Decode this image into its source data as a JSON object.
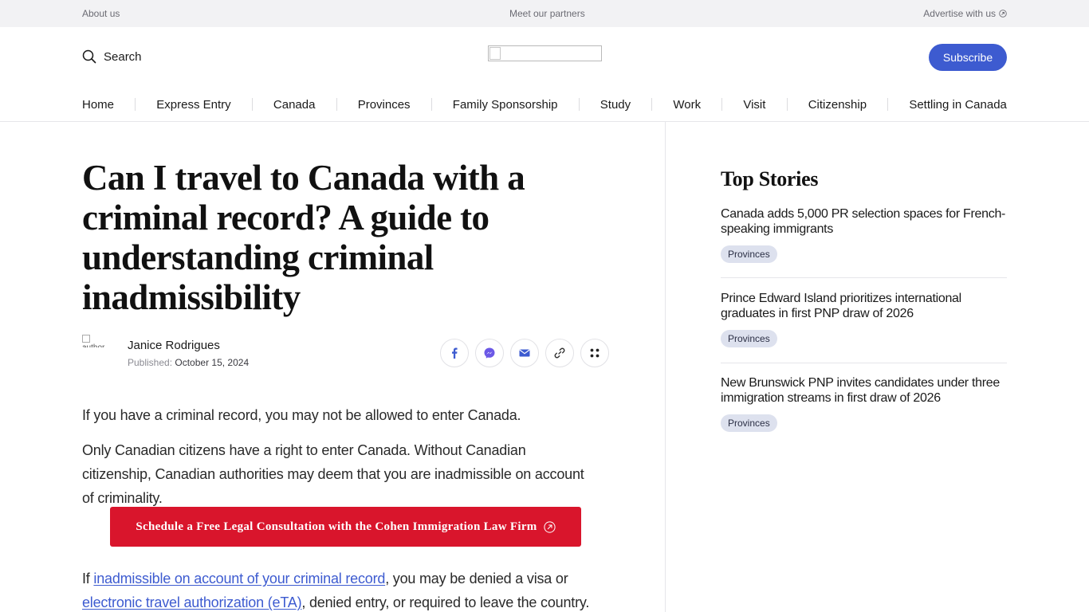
{
  "utility": {
    "about": "About us",
    "partners": "Meet our partners",
    "advertise": "Advertise with us"
  },
  "header": {
    "search_label": "Search",
    "subscribe_label": "Subscribe",
    "accent_color": "#3d5bd0"
  },
  "nav": [
    "Home",
    "Express Entry",
    "Canada",
    "Provinces",
    "Family Sponsorship",
    "Study",
    "Work",
    "Visit",
    "Citizenship",
    "Settling in Canada"
  ],
  "article": {
    "headline": "Can I travel to Canada with a criminal record? A guide to understanding criminal inadmissibility",
    "author_img_alt": "author",
    "author": "Janice Rodrigues",
    "published_label": "Published:",
    "published_date": "October 15, 2024",
    "share_icons": [
      "facebook-icon",
      "messenger-icon",
      "email-icon",
      "link-icon",
      "more-icon"
    ],
    "p1": "If you have a criminal record, you may not be allowed to enter Canada.",
    "p2": "Only Canadian citizens have a right to enter Canada. Without Canadian citizenship, Canadian authorities may deem that you are inadmissible on account of criminality.",
    "cta": "Schedule a Free Legal Consultation with the Cohen Immigration Law Firm",
    "cta_color": "#d9152c",
    "p3_start": "If ",
    "p3_link1": "inadmissible on account of your criminal record",
    "p3_mid": ", you may be denied a visa or ",
    "p3_link2": "electronic travel authorization (eTA)",
    "p3_end": ", denied entry, or required to leave the country."
  },
  "sidebar": {
    "title": "Top Stories",
    "stories": [
      {
        "title": "Canada adds 5,000 PR selection spaces for French-speaking immigrants",
        "tag": "Provinces"
      },
      {
        "title": "Prince Edward Island prioritizes international graduates in first PNP draw of 2026",
        "tag": "Provinces"
      },
      {
        "title": "New Brunswick PNP invites candidates under three immigration streams in first draw of 2026",
        "tag": "Provinces"
      }
    ]
  }
}
